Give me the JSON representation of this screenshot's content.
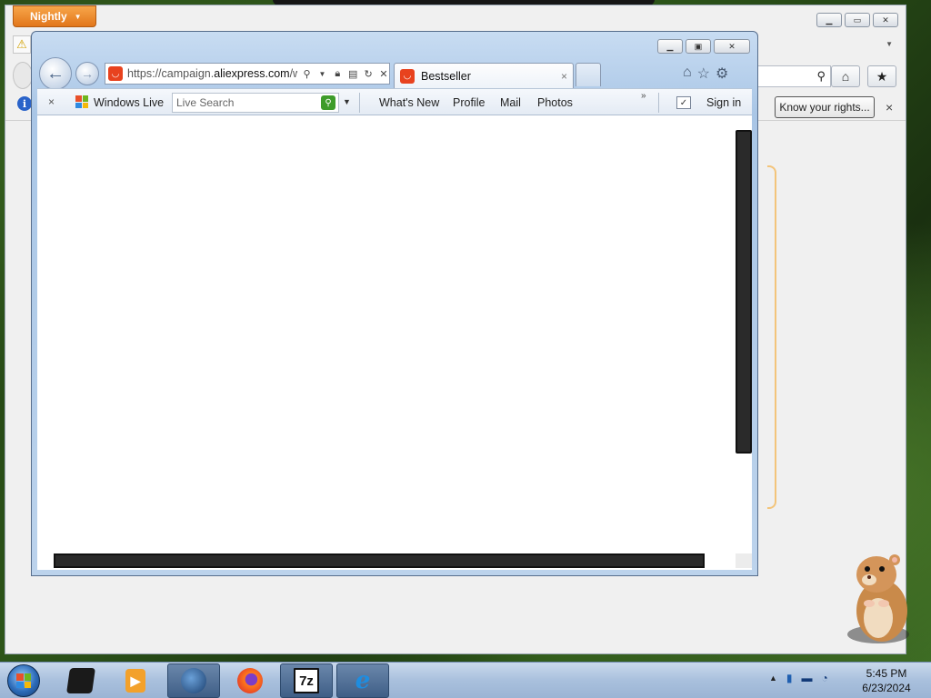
{
  "background_window": {
    "menu_button_label": "Nightly",
    "know_rights_label": "Know your rights...",
    "know_rights_close": "×"
  },
  "ie_window": {
    "address": {
      "prefix": "https://campaign.",
      "domain": "aliexpress.com",
      "suffix": "/w"
    },
    "tab": {
      "title": "Bestseller",
      "close": "×"
    },
    "command_bar": {
      "close": "×",
      "windows_live_label": "Windows Live",
      "search_placeholder": "Live Search",
      "links": [
        "What's New",
        "Profile",
        "Mail",
        "Photos"
      ],
      "more": "»",
      "sign_in": "Sign in"
    }
  },
  "taskbar": {
    "time": "5:45 PM",
    "date": "6/23/2024",
    "apps": [
      "device-manager",
      "media-player",
      "network-globe",
      "firefox",
      "7-zip",
      "internet-explorer"
    ],
    "seven_zip_label": "7z"
  },
  "colors": {
    "nightly_orange": "#e2761a",
    "aliexpress_red": "#e8421e",
    "ie_frame": "#a9c6e6",
    "search_green": "#3e9c2a"
  }
}
